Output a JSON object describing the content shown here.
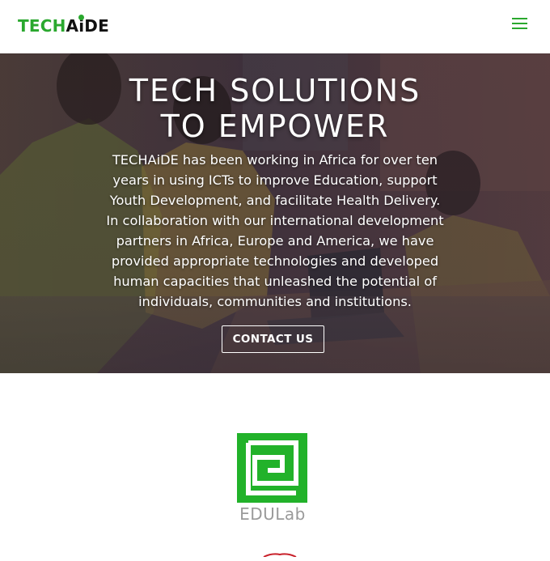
{
  "header": {
    "logo": {
      "part1": "TECH",
      "part2": "AiDE"
    },
    "menu_icon": "hamburger-menu-icon"
  },
  "hero": {
    "title_lines": [
      "TECH SOLUTIONS",
      "TO EMPOWER"
    ],
    "body_lines": [
      "TECHAiDE has been working in Africa for over ten",
      "years in using ICTs to improve Education, support",
      "Youth Development, and facilitate Health Delivery.",
      "In collaboration with our international development",
      "partners in Africa, Europe and America, we have",
      "provided appropriate technologies and developed",
      "human capacities that unleashed the potential of",
      "individuals, communities and institutions."
    ],
    "cta_label": "CONTACT US"
  },
  "partners": {
    "edulab_label": "EDULab"
  },
  "colors": {
    "brand_green": "#2aa82e",
    "edulab_green": "#22b22a",
    "text_white": "#ffffff"
  }
}
